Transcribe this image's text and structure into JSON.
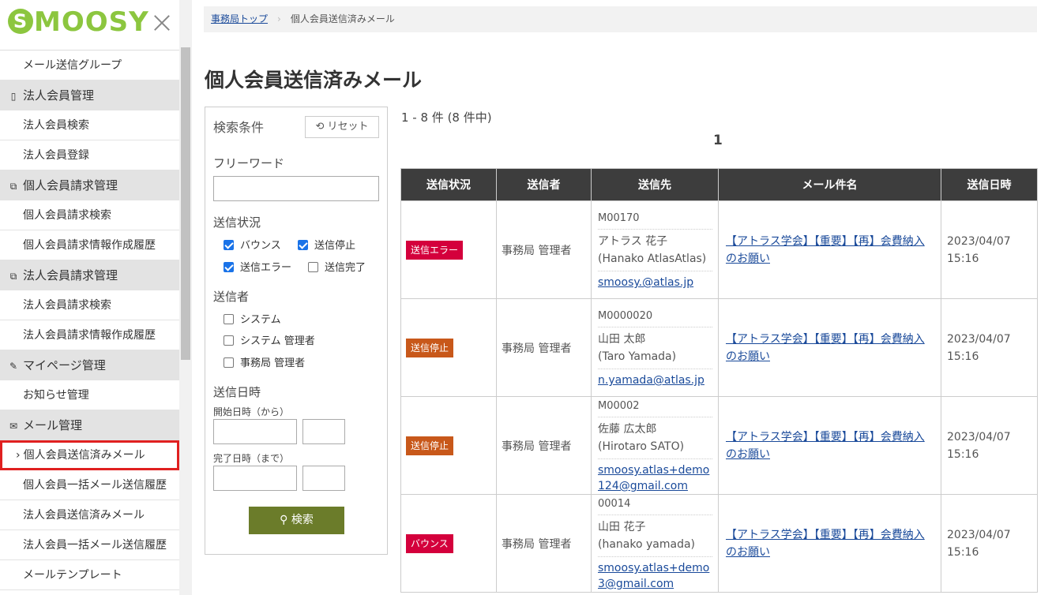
{
  "app": {
    "logo_text": "MOOSY",
    "logo_initial": "S"
  },
  "sidebar": {
    "items": [
      {
        "type": "item",
        "label": "メール送信グループ"
      },
      {
        "type": "group",
        "icon": "tablet-icon",
        "label": "法人会員管理"
      },
      {
        "type": "item",
        "label": "法人会員検索"
      },
      {
        "type": "item",
        "label": "法人会員登録"
      },
      {
        "type": "group",
        "icon": "copy-icon",
        "label": "個人会員請求管理"
      },
      {
        "type": "item",
        "label": "個人会員請求検索"
      },
      {
        "type": "item",
        "label": "個人会員請求情報作成履歴"
      },
      {
        "type": "group",
        "icon": "copy-icon",
        "label": "法人会員請求管理"
      },
      {
        "type": "item",
        "label": "法人会員請求検索"
      },
      {
        "type": "item",
        "label": "法人会員請求情報作成履歴"
      },
      {
        "type": "group",
        "icon": "pencil-icon",
        "label": "マイページ管理"
      },
      {
        "type": "item",
        "label": "お知らせ管理"
      },
      {
        "type": "group",
        "icon": "mail-icon",
        "label": "メール管理"
      },
      {
        "type": "item",
        "label": "個人会員送信済みメール",
        "active": true
      },
      {
        "type": "item",
        "label": "個人会員一括メール送信履歴"
      },
      {
        "type": "item",
        "label": "法人会員送信済みメール"
      },
      {
        "type": "item",
        "label": "法人会員一括メール送信履歴"
      },
      {
        "type": "item",
        "label": "メールテンプレート"
      }
    ]
  },
  "breadcrumb": {
    "home": "事務局トップ",
    "current": "個人会員送信済みメール"
  },
  "page": {
    "title": "個人会員送信済みメール"
  },
  "search": {
    "title": "検索条件",
    "reset_label": "リセット",
    "freeword_label": "フリーワード",
    "freeword_value": "",
    "status_label": "送信状況",
    "status_options": [
      {
        "label": "バウンス",
        "checked": true
      },
      {
        "label": "送信停止",
        "checked": true
      },
      {
        "label": "送信エラー",
        "checked": true
      },
      {
        "label": "送信完了",
        "checked": false
      }
    ],
    "sender_label": "送信者",
    "sender_options": [
      {
        "label": "システム",
        "checked": false
      },
      {
        "label": "システム 管理者",
        "checked": false
      },
      {
        "label": "事務局 管理者",
        "checked": false
      }
    ],
    "date_label": "送信日時",
    "start_label": "開始日時（から）",
    "end_label": "完了日時（まで）",
    "search_label": "検索"
  },
  "results": {
    "count_text": "1 - 8 件 (8 件中)",
    "page": "1",
    "columns": [
      "送信状況",
      "送信者",
      "送信先",
      "メール件名",
      "送信日時"
    ],
    "rows": [
      {
        "status": "送信エラー",
        "status_kind": "err",
        "sender": "事務局 管理者",
        "to_id": "M00170",
        "to_name": "アトラス 花子\n(Hanako AtlasAtlas)",
        "to_mail": "smoosy.@atlas.jp",
        "subject": "【アトラス学会】【重要】【再】会費納入のお願い",
        "date": "2023/04/07\n15:16"
      },
      {
        "status": "送信停止",
        "status_kind": "stop",
        "sender": "事務局 管理者",
        "to_id": "M0000020",
        "to_name": "山田 太郎\n(Taro Yamada)",
        "to_mail": "n.yamada@atlas.jp",
        "subject": "【アトラス学会】【重要】【再】会費納入のお願い",
        "date": "2023/04/07\n15:16"
      },
      {
        "status": "送信停止",
        "status_kind": "stop",
        "sender": "事務局 管理者",
        "to_id": "M00002",
        "to_name": "佐藤 広太郎\n(Hirotaro SATO)",
        "to_mail": "smoosy.atlas+demo124@gmail.com",
        "subject": "【アトラス学会】【重要】【再】会費納入のお願い",
        "date": "2023/04/07\n15:16"
      },
      {
        "status": "バウンス",
        "status_kind": "bounce",
        "sender": "事務局 管理者",
        "to_id": "00014",
        "to_name": "山田 花子\n(hanako yamada)",
        "to_mail": "smoosy.atlas+demo3@gmail.com",
        "subject": "【アトラス学会】【重要】【再】会費納入のお願い",
        "date": "2023/04/07\n15:16"
      }
    ]
  }
}
